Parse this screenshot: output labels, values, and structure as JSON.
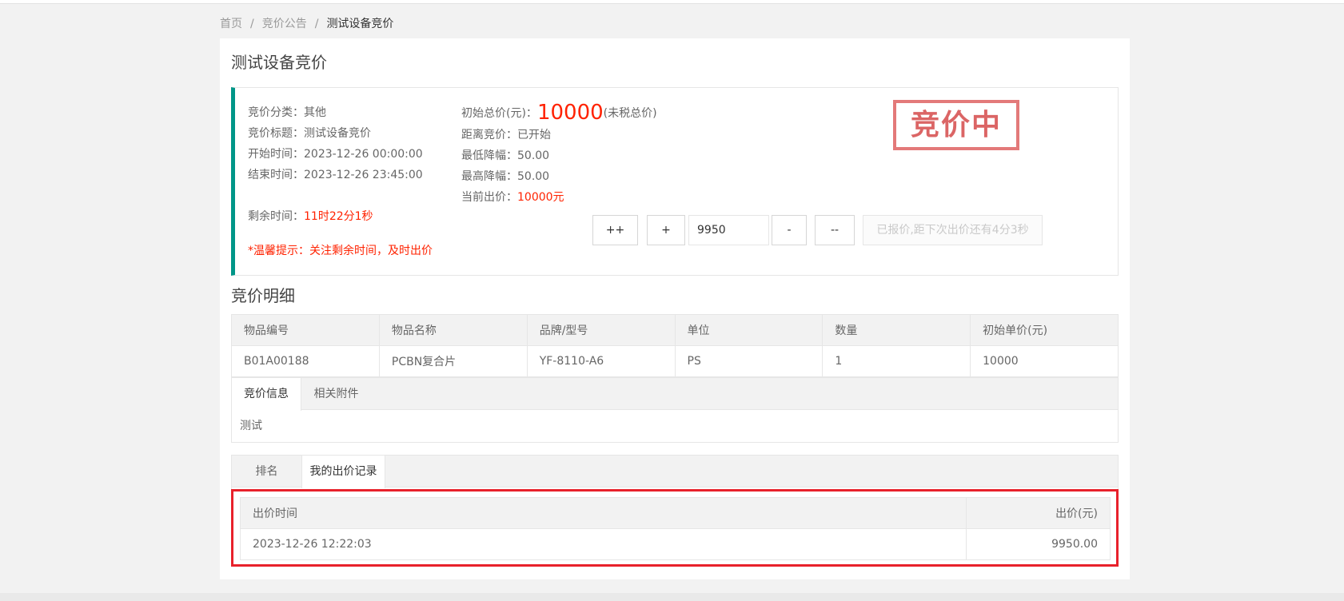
{
  "breadcrumb": {
    "home": "首页",
    "sep": "/",
    "announcement": "竞价公告",
    "current": "测试设备竞价"
  },
  "page_title": "测试设备竞价",
  "info": {
    "category_label": "竞价分类：",
    "category": "其他",
    "title_label": "竞价标题：",
    "title": "测试设备竞价",
    "start_label": "开始时间：",
    "start": "2023-12-26 00:00:00",
    "end_label": "结束时间：",
    "end": "2023-12-26 23:45:00",
    "remaining_label": "剩余时间：",
    "remaining": "11时22分1秒",
    "tip": "*温馨提示：关注剩余时间，及时出价",
    "initial_total_label": "初始总价(元)：",
    "initial_total": "10000",
    "initial_total_note": "(未税总价)",
    "distance_label": "距离竞价：",
    "distance": "已开始",
    "min_drop_label": "最低降幅：",
    "min_drop": "50.00",
    "max_drop_label": "最高降幅：",
    "max_drop": "50.00",
    "current_bid_label": "当前出价：",
    "current_bid": "10000元",
    "stamp": "竞价中"
  },
  "controls": {
    "plus_plus": "++",
    "plus": "+",
    "bid_value": "9950",
    "minus": "-",
    "minus_minus": "--",
    "submit_disabled": "已报价,距下次出价还有4分3秒"
  },
  "detail": {
    "title": "竞价明细",
    "headers": [
      "物品编号",
      "物品名称",
      "品牌/型号",
      "单位",
      "数量",
      "初始单价(元)"
    ],
    "row": [
      "B01A00188",
      "PCBN复合片",
      "YF-8110-A6",
      "PS",
      "1",
      "10000"
    ]
  },
  "tabs1": {
    "items": [
      "竞价信息",
      "相关附件"
    ],
    "content": "测试"
  },
  "tabs2": {
    "items": [
      "排名",
      "我的出价记录"
    ]
  },
  "records": {
    "headers": [
      "出价时间",
      "出价(元)"
    ],
    "row": [
      "2023-12-26 12:22:03",
      "9950.00"
    ]
  },
  "colors": {
    "accent": "#009688",
    "red": "#ff2200",
    "stamp": "#d85555",
    "highlight": "#e8212b"
  }
}
